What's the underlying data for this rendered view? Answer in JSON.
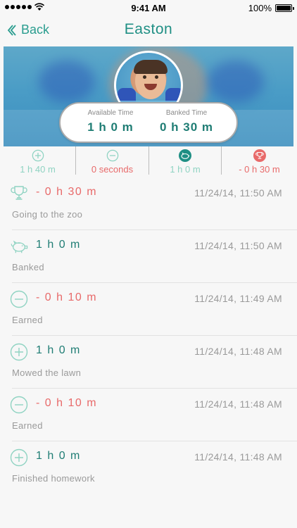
{
  "status": {
    "time": "9:41 AM",
    "battery": "100%"
  },
  "nav": {
    "back_label": "Back",
    "title": "Easton"
  },
  "profile": {
    "available_label": "Available Time",
    "available_value": "1 h 0 m",
    "banked_label": "Banked Time",
    "banked_value": "0 h 30 m"
  },
  "summary": [
    {
      "icon": "plus-circle-icon",
      "value": "1 h 40 m",
      "color": "#8fd3c2"
    },
    {
      "icon": "minus-circle-icon",
      "value": "0 seconds",
      "color": "#e86a6a"
    },
    {
      "icon": "piggy-bank-icon",
      "value": "1 h 0 m",
      "color": "#8fd3c2"
    },
    {
      "icon": "trophy-icon",
      "value": "- 0 h 30 m",
      "color": "#e86a6a"
    }
  ],
  "entries": [
    {
      "icon": "trophy-icon",
      "amount": "- 0 h 30 m",
      "amount_color": "red",
      "date": "11/24/14, 11:50 AM",
      "note": "Going to the zoo"
    },
    {
      "icon": "piggy-bank-icon",
      "amount": "1 h 0 m",
      "amount_color": "teal",
      "date": "11/24/14, 11:50 AM",
      "note": "Banked"
    },
    {
      "icon": "minus-circle-icon",
      "amount": "- 0 h 10 m",
      "amount_color": "red",
      "date": "11/24/14, 11:49 AM",
      "note": "Earned"
    },
    {
      "icon": "plus-circle-icon",
      "amount": "1 h 0 m",
      "amount_color": "teal",
      "date": "11/24/14, 11:48 AM",
      "note": "Mowed the lawn"
    },
    {
      "icon": "minus-circle-icon",
      "amount": "- 0 h 10 m",
      "amount_color": "red",
      "date": "11/24/14, 11:48 AM",
      "note": "Earned"
    },
    {
      "icon": "plus-circle-icon",
      "amount": "1 h 0 m",
      "amount_color": "teal",
      "date": "11/24/14, 11:48 AM",
      "note": "Finished homework"
    }
  ]
}
